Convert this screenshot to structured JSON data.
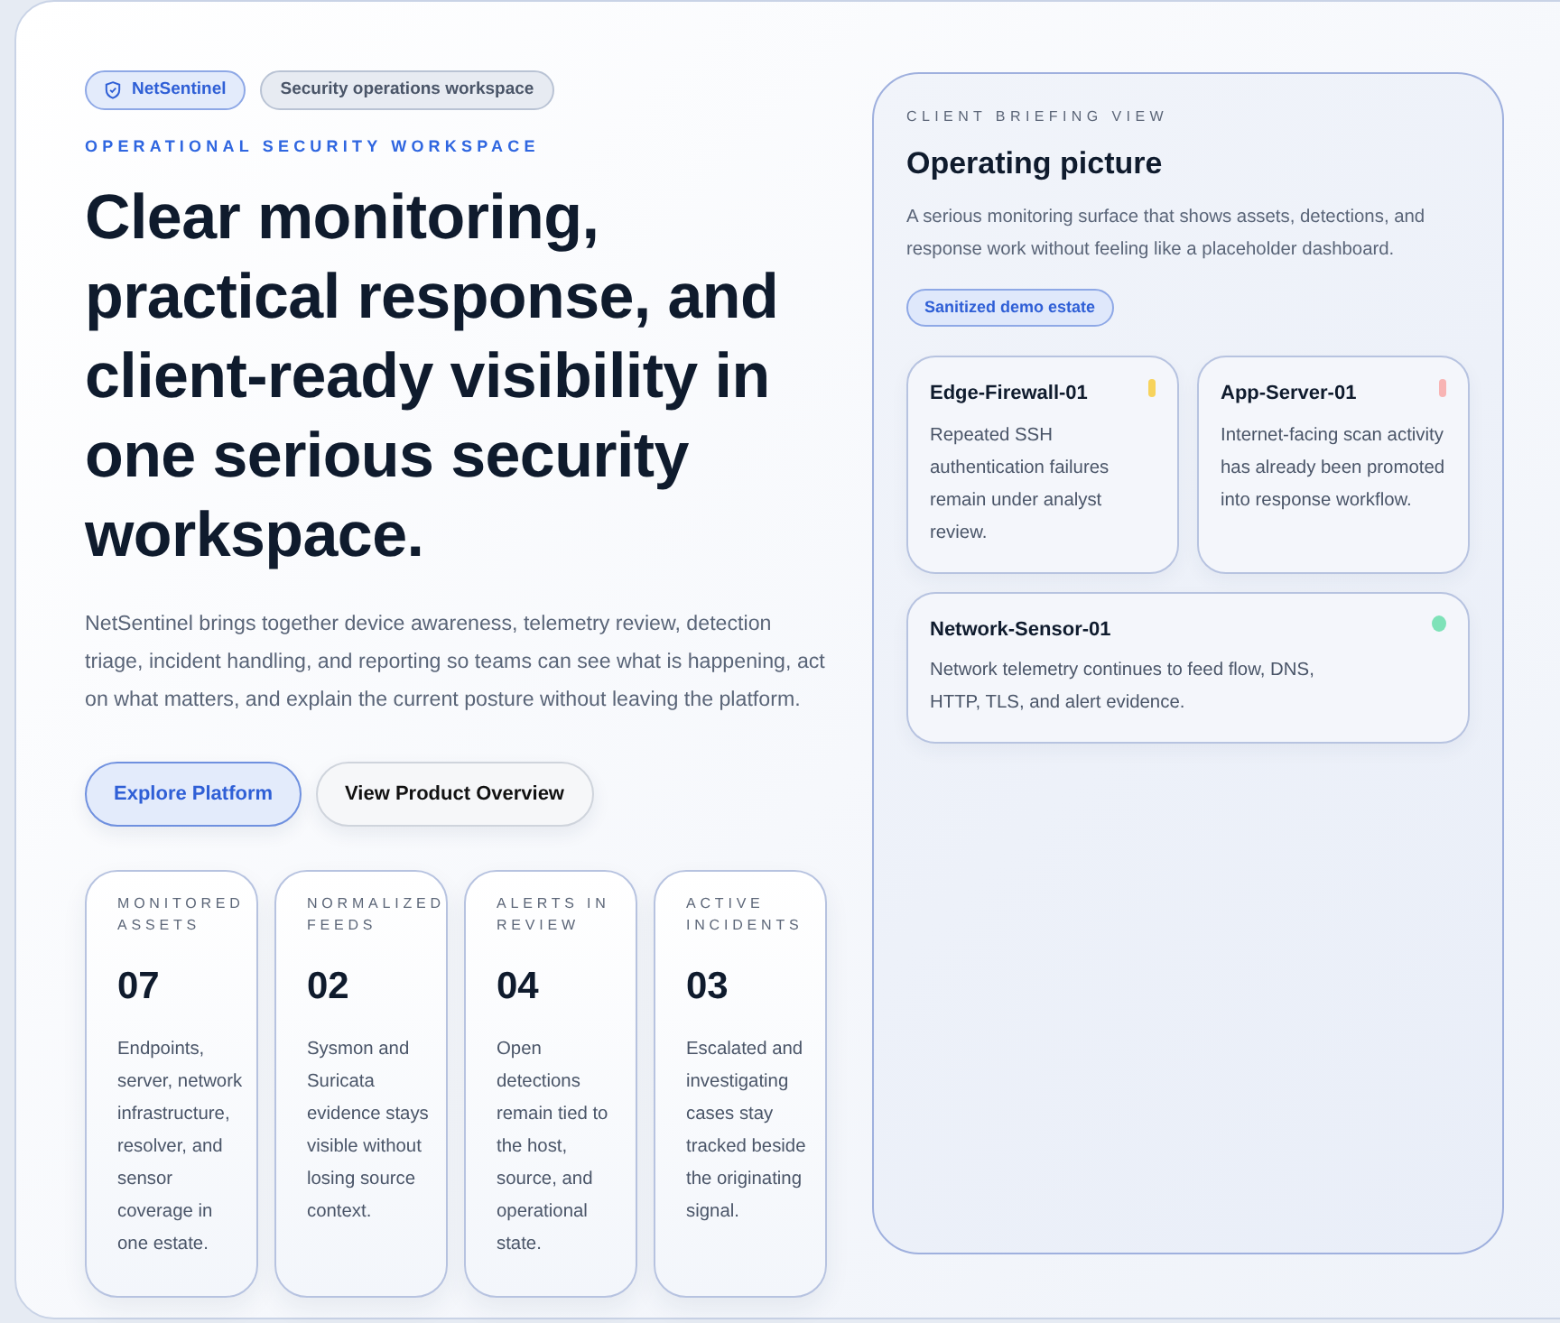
{
  "badges": [
    {
      "label": "NetSentinel",
      "kind": "brand"
    },
    {
      "label": "Security operations workspace",
      "kind": "plain"
    }
  ],
  "eyebrow": "OPERATIONAL SECURITY WORKSPACE",
  "headline": "Clear monitoring, practical response, and client-ready visibility in one serious security workspace.",
  "intro": "NetSentinel brings together device awareness, telemetry review, detection triage, incident handling, and reporting so teams can see what is happening, act on what matters, and explain the current posture without leaving the platform.",
  "buttons": [
    {
      "label": "Explore Platform",
      "kind": "primary"
    },
    {
      "label": "View Product Overview",
      "kind": "secondary"
    }
  ],
  "metrics": [
    {
      "label": "MONITORED ASSETS",
      "value": "07",
      "text": "Endpoints, server, network infrastructure, resolver, and sensor coverage in one estate."
    },
    {
      "label": "NORMALIZED FEEDS",
      "value": "02",
      "text": "Sysmon and Suricata evidence stays visible without losing source context."
    },
    {
      "label": "ALERTS IN REVIEW",
      "value": "04",
      "text": "Open detections remain tied to the host, source, and operational state."
    },
    {
      "label": "ACTIVE INCIDENTS",
      "value": "03",
      "text": "Escalated and investigating cases stay tracked beside the originating signal."
    }
  ],
  "briefing": {
    "eyebrow": "CLIENT BRIEFING VIEW",
    "title": "Operating picture",
    "text": "A serious monitoring surface that shows assets, detections, and response work without feeling like a placeholder dashboard.",
    "tag": "Sanitized demo estate",
    "hosts": [
      {
        "name": "Edge-Firewall-01",
        "text": "Repeated SSH authentication failures remain under analyst review.",
        "color": "#f7d35c",
        "kind": "bar"
      },
      {
        "name": "App-Server-01",
        "text": "Internet-facing scan activity has already been promoted into response workflow.",
        "color": "#f8b4b4",
        "kind": "bar"
      },
      {
        "name": "Network-Sensor-01",
        "text": "Network telemetry continues to feed flow, DNS, HTTP, TLS, and alert evidence.",
        "color": "#7ee2b8",
        "kind": "dot"
      }
    ]
  }
}
